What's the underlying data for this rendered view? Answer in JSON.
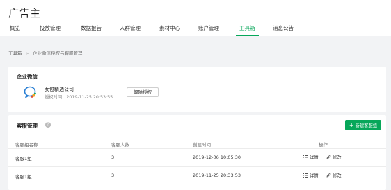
{
  "header": {
    "title": "广告主"
  },
  "nav": {
    "items": [
      {
        "label": "概览"
      },
      {
        "label": "投放管理"
      },
      {
        "label": "数据报告"
      },
      {
        "label": "人群管理"
      },
      {
        "label": "素材中心"
      },
      {
        "label": "账户管理"
      },
      {
        "label": "工具箱"
      },
      {
        "label": "消息公告"
      }
    ],
    "active_index": 6
  },
  "breadcrumb": {
    "root": "工具箱",
    "current": "企业微信授权与客服管理"
  },
  "wechat_card": {
    "title": "企业微信",
    "company_name": "女包精选公司",
    "auth_time_label": "授权时间:",
    "auth_time_value": "2019-11-25 20:53:55",
    "revoke_label": "解除授权"
  },
  "service_card": {
    "title": "客服管理",
    "new_group_label": "新建客服组",
    "columns": [
      "客服组名称",
      "客服人数",
      "创建时间",
      "操作"
    ],
    "rows": [
      {
        "name": "客服1组",
        "count": "3",
        "created": "2019-12-06 10:05:30",
        "detail": "详情",
        "edit": "修改"
      },
      {
        "name": "客服1组",
        "count": "3",
        "created": "2019-11-25 20:33:53",
        "detail": "详情",
        "edit": "修改"
      }
    ]
  },
  "colors": {
    "accent": "#07a75a",
    "background": "#f2f3f5",
    "card": "#ffffff"
  }
}
